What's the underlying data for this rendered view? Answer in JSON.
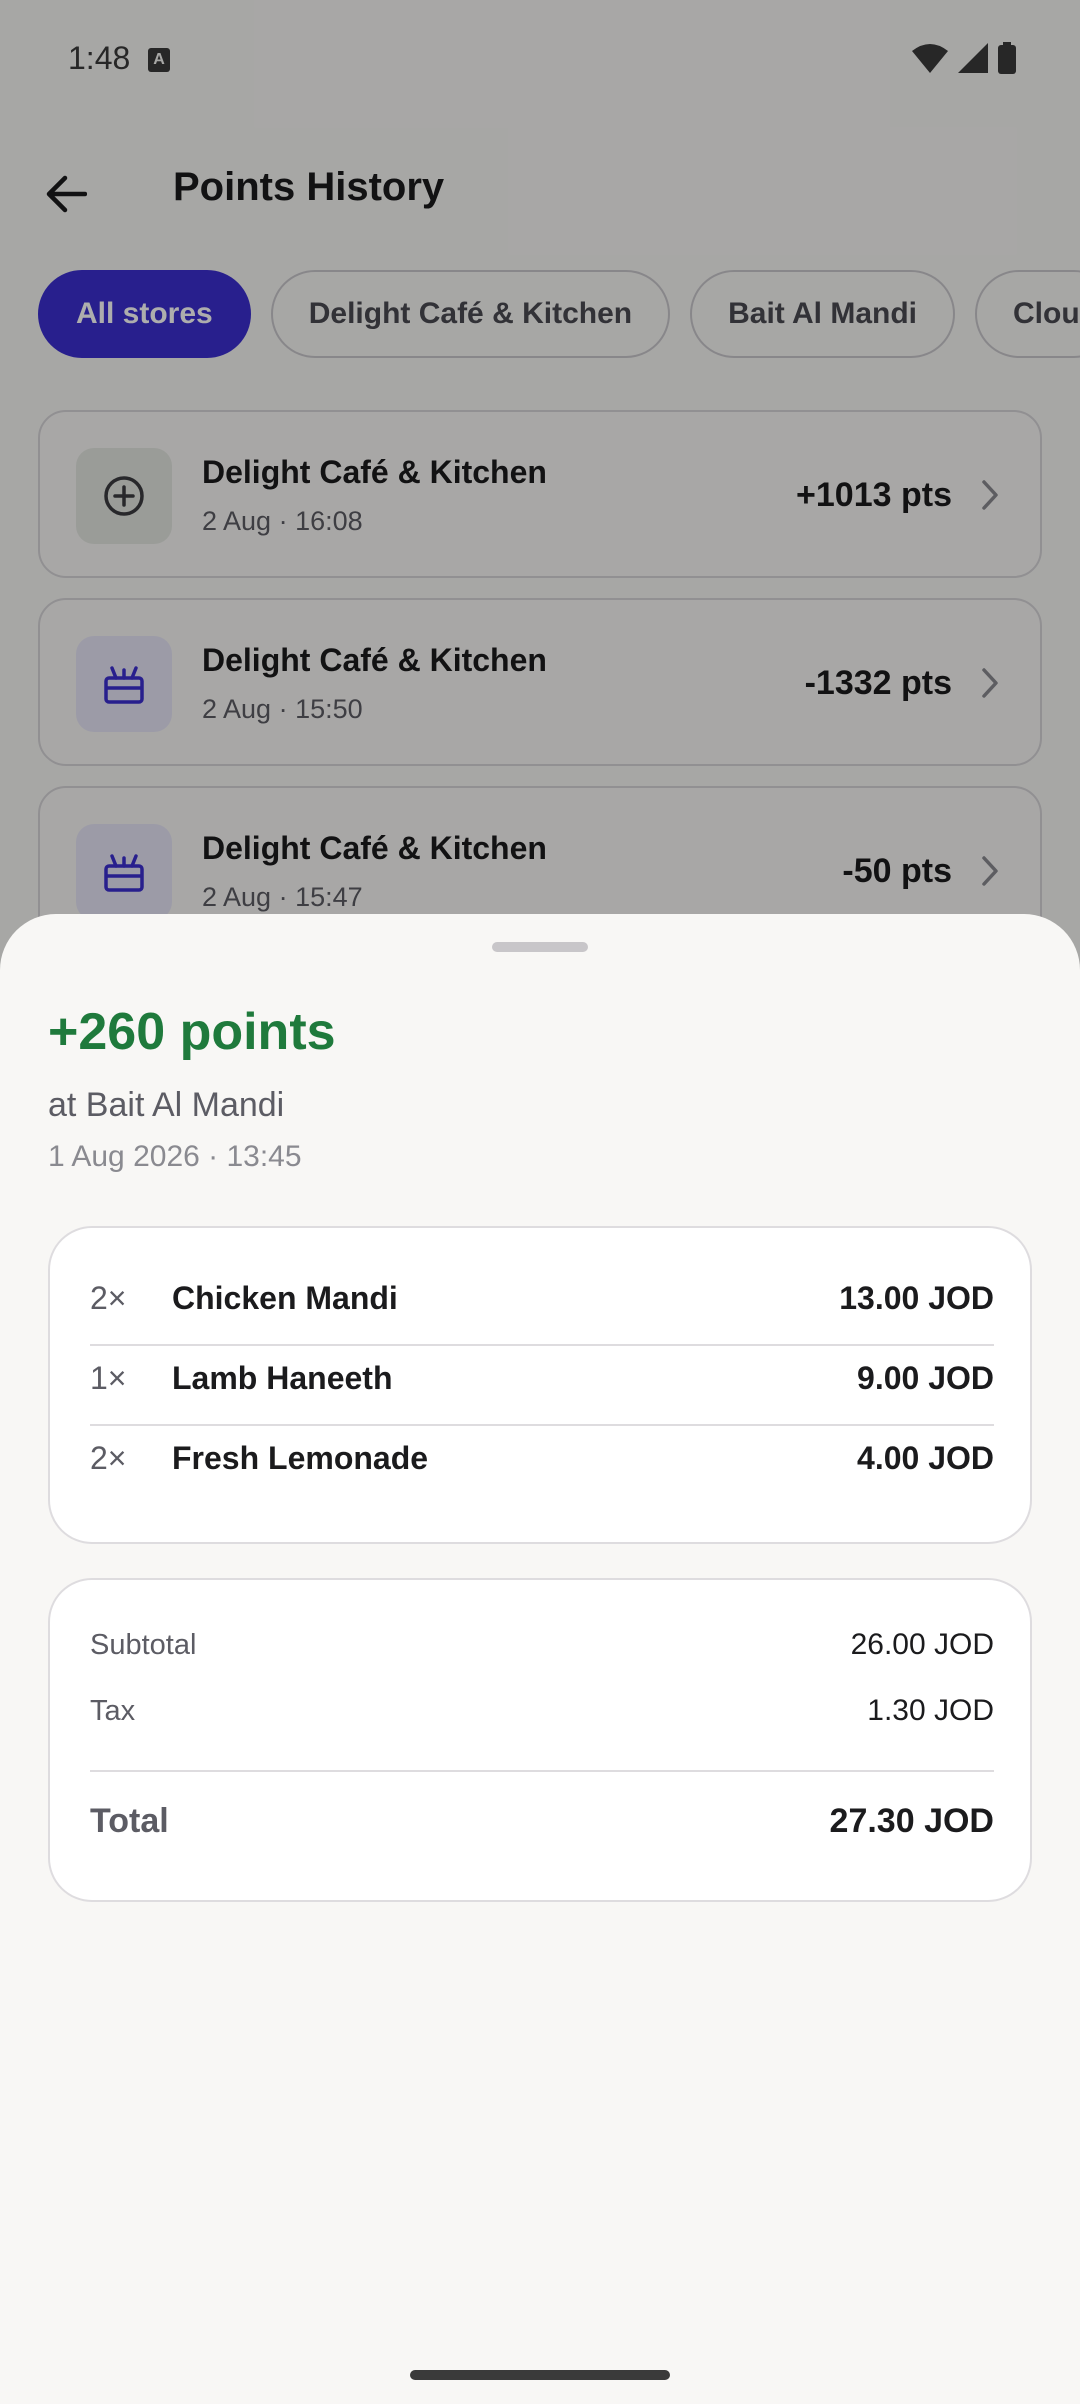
{
  "status": {
    "time": "1:48",
    "badge": "A"
  },
  "header": {
    "title": "Points History"
  },
  "filters": [
    {
      "label": "All stores",
      "active": true
    },
    {
      "label": "Delight Café & Kitchen",
      "active": false
    },
    {
      "label": "Bait Al Mandi",
      "active": false
    },
    {
      "label": "Clou",
      "active": false
    }
  ],
  "history": [
    {
      "store": "Delight Café & Kitchen",
      "date": "2 Aug · 16:08",
      "points": "+1013 pts",
      "type": "earn"
    },
    {
      "store": "Delight Café & Kitchen",
      "date": "2 Aug · 15:50",
      "points": "-1332 pts",
      "type": "redeem"
    },
    {
      "store": "Delight Café & Kitchen",
      "date": "2 Aug · 15:47",
      "points": "-50 pts",
      "type": "redeem"
    }
  ],
  "sheet": {
    "title": "+260 points",
    "store": "at Bait Al Mandi",
    "datetime": "1 Aug 2026 · 13:45",
    "items": [
      {
        "qty": "2×",
        "name": "Chicken Mandi",
        "price": "13.00 JOD"
      },
      {
        "qty": "1×",
        "name": "Lamb Haneeth",
        "price": "9.00 JOD"
      },
      {
        "qty": "2×",
        "name": "Fresh Lemonade",
        "price": "4.00 JOD"
      }
    ],
    "subtotal_label": "Subtotal",
    "subtotal": "26.00 JOD",
    "tax_label": "Tax",
    "tax": "1.30 JOD",
    "total_label": "Total",
    "total": "27.30 JOD"
  },
  "colors": {
    "accent": "#3b2fd0",
    "earn": "#1f7a3c"
  },
  "icons": {
    "back": "arrow-left-icon",
    "earn": "plus-circle-icon",
    "redeem": "gift-icon",
    "chevron": "chevron-right-icon"
  }
}
